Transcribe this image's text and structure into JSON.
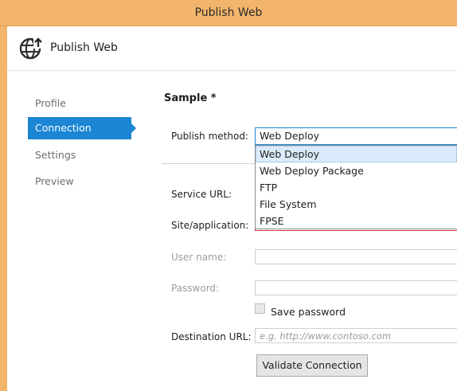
{
  "window": {
    "title": "Publish Web"
  },
  "header": {
    "title": "Publish Web",
    "icon": "globe-publish-icon"
  },
  "sidebar": {
    "items": [
      {
        "label": "Profile"
      },
      {
        "label": "Connection"
      },
      {
        "label": "Settings"
      },
      {
        "label": "Preview"
      }
    ],
    "active": "Connection"
  },
  "main": {
    "section_title": "Sample *",
    "publish_method": {
      "label": "Publish method:",
      "value": "Web Deploy"
    },
    "service_url": {
      "label": "Service URL:",
      "value": ""
    },
    "site_application": {
      "label": "Site/application:",
      "value": ""
    },
    "user_name": {
      "label": "User name:",
      "value": ""
    },
    "password": {
      "label": "Password:",
      "value": ""
    },
    "save_password": {
      "label": "Save password",
      "checked": false
    },
    "destination_url": {
      "label": "Destination URL:",
      "placeholder": "e.g. http://www.contoso.com"
    },
    "validate_button": "Validate Connection"
  },
  "dropdown": {
    "options": [
      "Web Deploy",
      "Web Deploy Package",
      "FTP",
      "File System",
      "FPSE"
    ],
    "selected": "Web Deploy"
  },
  "colors": {
    "titlebar": "#f2b56b",
    "accent": "#1c86d4",
    "error_border": "#d23a3a"
  }
}
